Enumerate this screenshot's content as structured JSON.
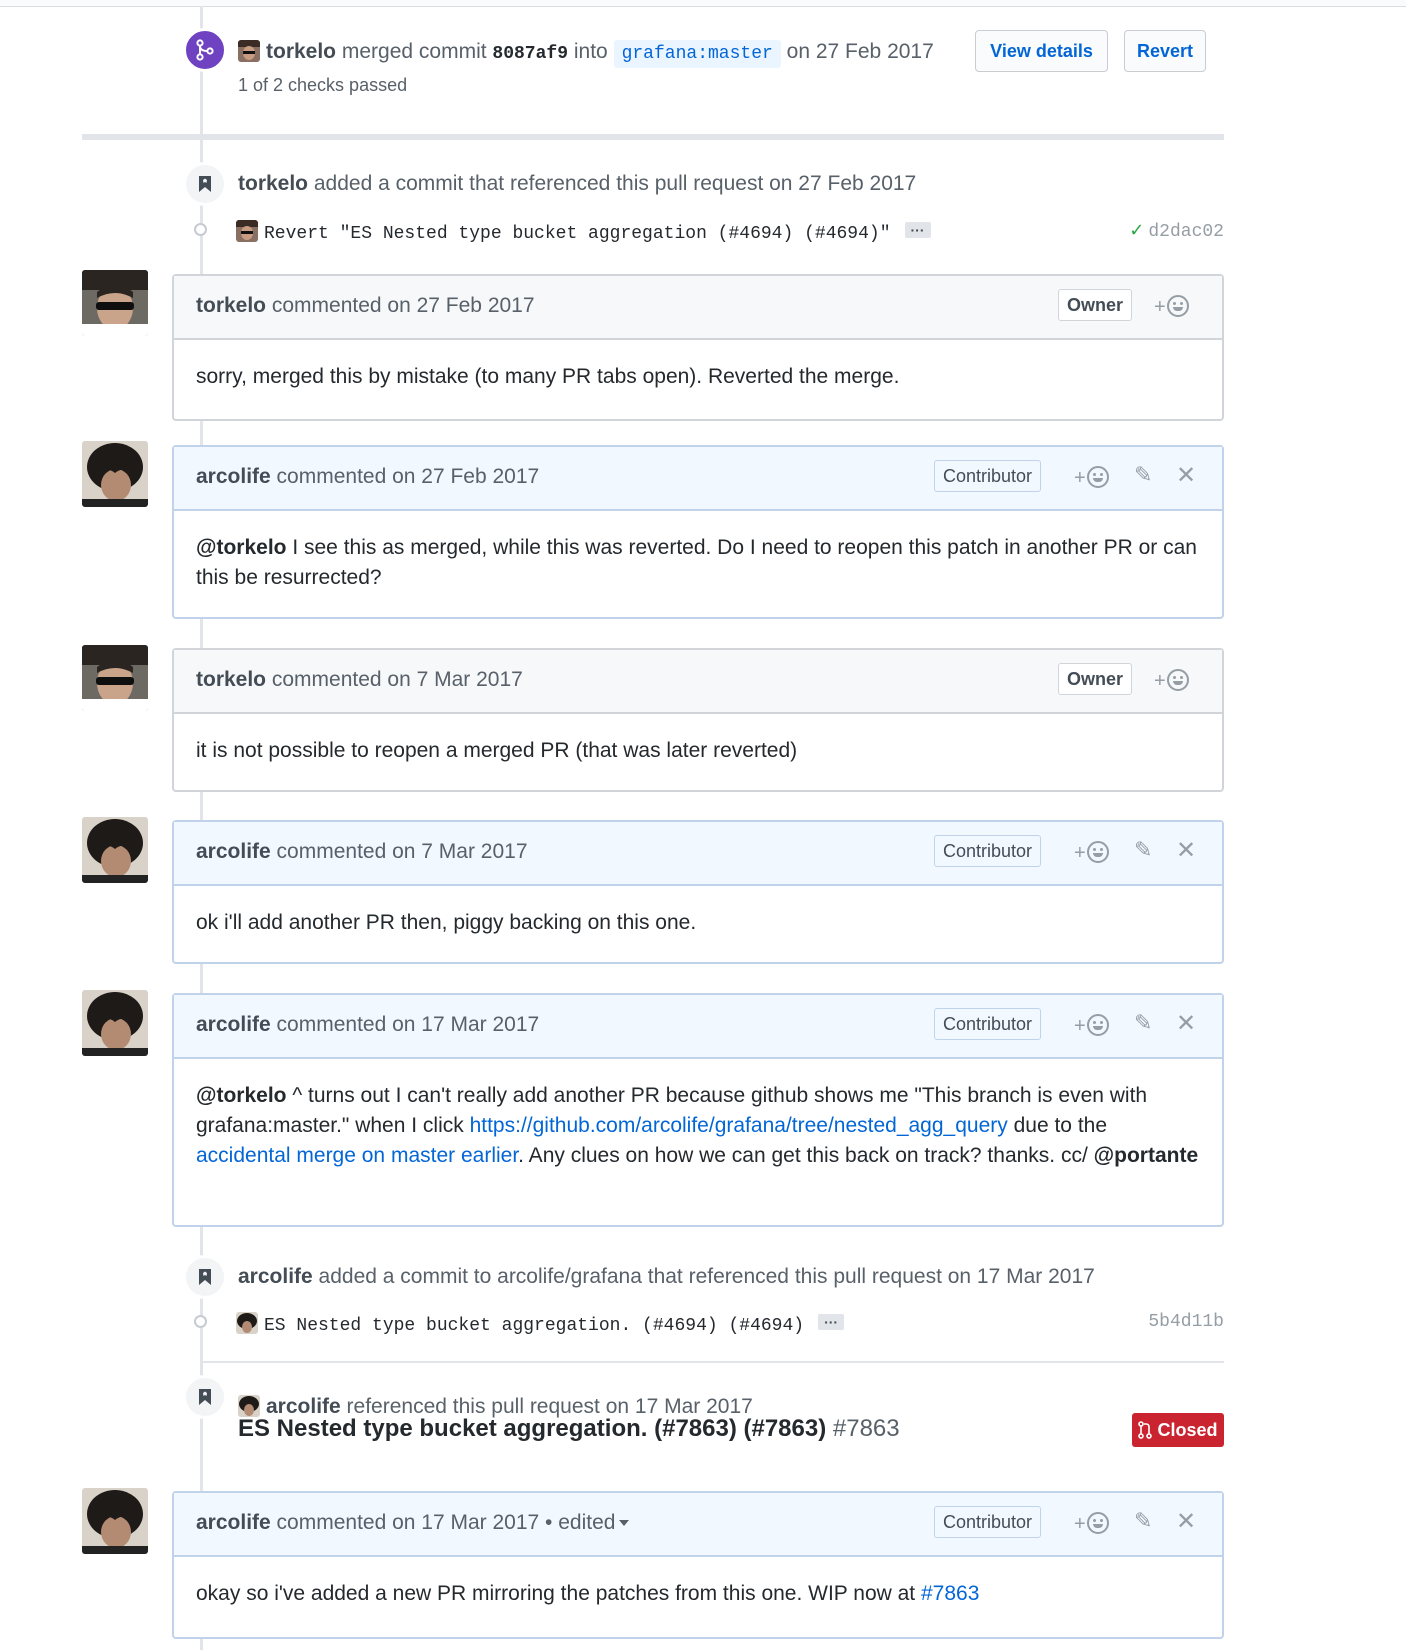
{
  "merge_event": {
    "author": "torkelo",
    "action_before": "merged commit",
    "commit": "8087af9",
    "into": "into",
    "branch": "grafana:master",
    "date": "on 27 Feb 2017",
    "checks": "1 of 2 checks passed",
    "view_details": "View details",
    "revert": "Revert"
  },
  "ref_event_1": {
    "author": "torkelo",
    "text": "added a commit that referenced this pull request on 27 Feb 2017",
    "commit_message": "Revert \"ES Nested type bucket aggregation (#4694) (#4694)\"",
    "ellipsis": "···",
    "sha": "d2dac02",
    "status_icon": "check-icon"
  },
  "comments": [
    {
      "author": "torkelo",
      "meta": "commented on 27 Feb 2017",
      "role": "Owner",
      "body": "sorry, merged this by mistake (to many PR tabs open). Reverted the merge."
    },
    {
      "author": "arcolife",
      "meta": "commented on 27 Feb 2017",
      "role": "Contributor",
      "mention": "@torkelo",
      "body": " I see this as merged, while this was reverted. Do I need to reopen this patch in another PR or can this be resurrected?"
    },
    {
      "author": "torkelo",
      "meta": "commented on 7 Mar 2017",
      "role": "Owner",
      "body": "it is not possible to reopen a merged PR (that was later reverted)"
    },
    {
      "author": "arcolife",
      "meta": "commented on 7 Mar 2017",
      "role": "Contributor",
      "body": "ok i'll add another PR then, piggy backing on this one."
    },
    {
      "author": "arcolife",
      "meta": "commented on 17 Mar 2017",
      "role": "Contributor",
      "mention": "@torkelo",
      "part1": " ^ turns out I can't really add another PR because github shows me \"This branch is even with grafana:master.\" when I click ",
      "link1": "https://github.com/arcolife/grafana/tree/nested_agg_query",
      "part2": " due to the ",
      "link2": "accidental merge on master earlier",
      "part3": ". Any clues on how we can get this back on track? thanks. cc/ ",
      "mention2": "@portante"
    },
    {
      "author": "arcolife",
      "meta": "commented on 17 Mar 2017",
      "edited": "• edited",
      "role": "Contributor",
      "body_before": "okay so i've added a new PR mirroring the patches from this one. WIP now at ",
      "link": "#7863"
    }
  ],
  "ref_event_2": {
    "author": "arcolife",
    "text": "added a commit to arcolife/grafana that referenced this pull request on 17 Mar 2017",
    "commit_message": "ES Nested type bucket aggregation. (#4694) (#4694)",
    "ellipsis": "···",
    "sha": "5b4d11b"
  },
  "ref_event_3": {
    "author": "arcolife",
    "text": "referenced this pull request on 17 Mar 2017",
    "title": "ES Nested type bucket aggregation. (#7863) (#7863)",
    "number": "#7863",
    "status": "Closed"
  },
  "icons": {
    "merge": "git-merge-icon",
    "bookmark": "bookmark-icon",
    "reaction": "smiley-icon",
    "edit": "pencil-icon",
    "delete": "close-icon",
    "pr_closed": "git-pull-request-icon"
  },
  "colors": {
    "link": "#0366d6",
    "merge": "#6f42c1",
    "closed": "#cb2431",
    "success": "#28a745",
    "self_comment_header": "#f1f8ff"
  }
}
